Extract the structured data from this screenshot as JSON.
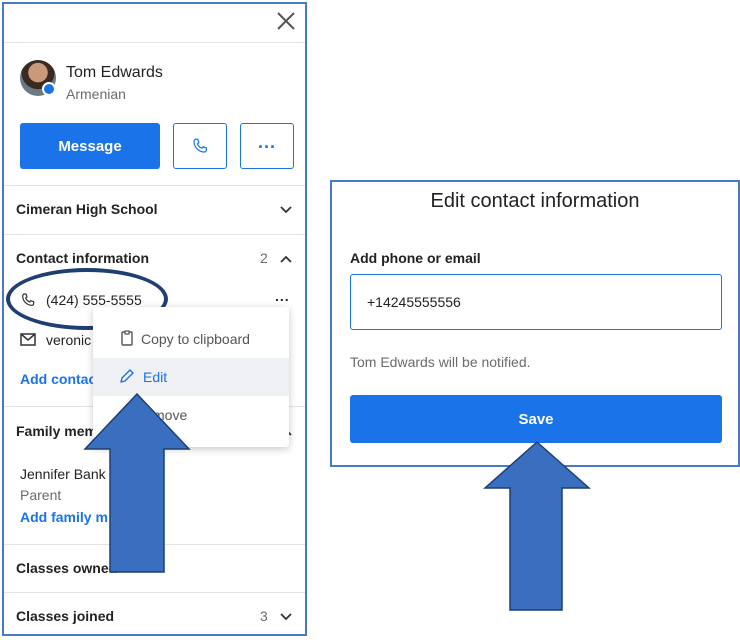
{
  "profile": {
    "name": "Tom Edwards",
    "language": "Armenian"
  },
  "actions": {
    "message_label": "Message",
    "more_label": "..."
  },
  "sections": {
    "school": "Cimeran High School",
    "contact_title": "Contact information",
    "contact_count": "2",
    "phone": "(424) 555-5555",
    "email_partial": "veronic",
    "add_contact_partial": "Add contac",
    "family_title_partial": "Family mem",
    "family_member_name": "Jennifer Bank",
    "family_member_role": "Parent",
    "add_family_partial": "Add family m",
    "classes_owned_partial": "Classes owned",
    "classes_joined": "Classes joined",
    "classes_joined_count": "3"
  },
  "menu": {
    "items": [
      {
        "label": "Copy to clipboard",
        "icon": "clipboard-icon"
      },
      {
        "label": "Edit",
        "icon": "pencil-icon"
      },
      {
        "label": "move",
        "icon": "trash-icon"
      }
    ]
  },
  "dialog": {
    "title": "Edit contact information",
    "field_label": "Add phone or email",
    "field_value": "+14245555556",
    "note": "Tom Edwards will be notified.",
    "save_label": "Save"
  },
  "colors": {
    "accent": "#1a73e8",
    "annotation": "#3a6fbf",
    "annotation_outline": "#1f3f73"
  }
}
